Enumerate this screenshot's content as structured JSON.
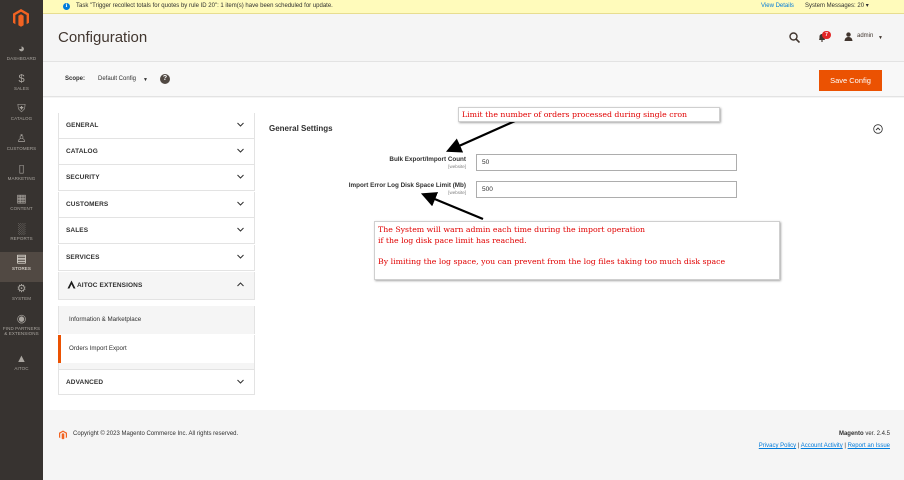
{
  "nav": {
    "items": [
      {
        "label": "DASHBOARD",
        "icon": "dashboard-icon"
      },
      {
        "label": "SALES",
        "icon": "dollar-icon"
      },
      {
        "label": "CATALOG",
        "icon": "cube-icon"
      },
      {
        "label": "CUSTOMERS",
        "icon": "person-icon"
      },
      {
        "label": "MARKETING",
        "icon": "megaphone-icon"
      },
      {
        "label": "CONTENT",
        "icon": "layout-icon"
      },
      {
        "label": "REPORTS",
        "icon": "bar-chart-icon"
      },
      {
        "label": "STORES",
        "icon": "store-icon"
      },
      {
        "label": "SYSTEM",
        "icon": "gear-icon"
      },
      {
        "label": "FIND PARTNERS",
        "label2": "& EXTENSIONS",
        "icon": "puzzle-icon"
      },
      {
        "label": "AITOC",
        "icon": "aitoc-icon"
      }
    ]
  },
  "message_bar": {
    "text": "Task \"Trigger recollect totals for quotes by rule ID 20\": 1 item(s) have been scheduled for update.",
    "view_details": "View Details",
    "system_messages": "System Messages: 20"
  },
  "header": {
    "title": "Configuration",
    "notification_count": "7",
    "user": "admin"
  },
  "scope": {
    "label": "Scope:",
    "value": "Default Config",
    "help": "?",
    "save_label": "Save Config"
  },
  "tabs": {
    "general": "GENERAL",
    "catalog": "CATALOG",
    "security": "SECURITY",
    "customers": "CUSTOMERS",
    "sales": "SALES",
    "services": "SERVICES",
    "aitoc": "AITOC EXTENSIONS",
    "aitoc_items": [
      "Information & Marketplace",
      "Orders Import Export"
    ],
    "advanced": "ADVANCED"
  },
  "section": {
    "title": "General Settings",
    "fields": [
      {
        "label": "Bulk Export/Import Count",
        "scope": "[website]",
        "value": "50"
      },
      {
        "label": "Import Error Log Disk Space Limit (Mb)",
        "scope": "[website]",
        "value": "500"
      }
    ]
  },
  "annotations": {
    "top": "Limit the number of orders processed during single cron",
    "bottom": [
      "The System will warn admin each time during the import operation",
      "if the log disk pace limit has reached.",
      "",
      "By limiting the log space, you can prevent from the log files taking too much disk space"
    ]
  },
  "footer": {
    "copyright": "Copyright © 2023 Magento Commerce Inc. All rights reserved.",
    "brand": "Magento",
    "version": "ver. 2.4.5",
    "links": [
      "Privacy Policy",
      "Account Activity",
      "Report an Issue"
    ],
    "separator": "|"
  },
  "colors": {
    "nav_bg": "#373330",
    "accent": "#eb5202",
    "link": "#007bdb",
    "annotation": "#e00000",
    "message_bg": "#fffbbb"
  }
}
